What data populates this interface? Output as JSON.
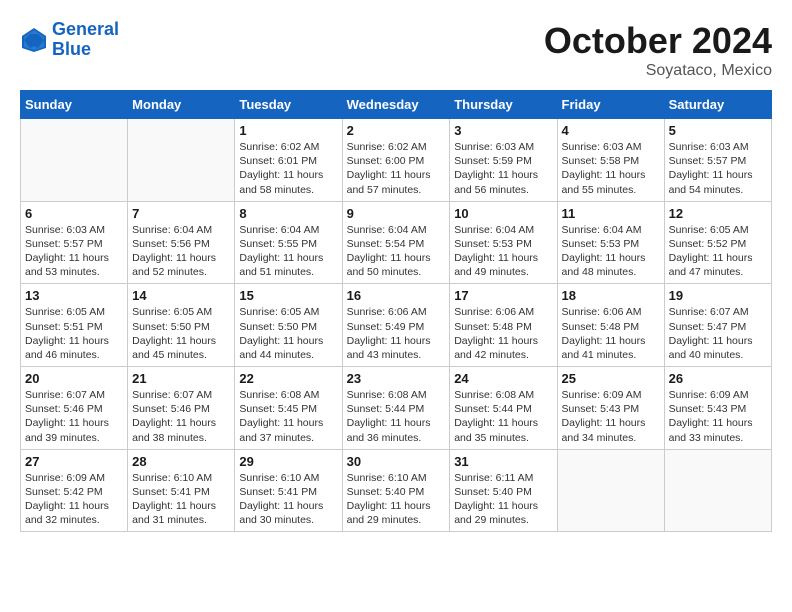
{
  "header": {
    "logo_line1": "General",
    "logo_line2": "Blue",
    "month": "October 2024",
    "location": "Soyataco, Mexico"
  },
  "weekdays": [
    "Sunday",
    "Monday",
    "Tuesday",
    "Wednesday",
    "Thursday",
    "Friday",
    "Saturday"
  ],
  "weeks": [
    [
      {
        "day": "",
        "info": ""
      },
      {
        "day": "",
        "info": ""
      },
      {
        "day": "1",
        "info": "Sunrise: 6:02 AM\nSunset: 6:01 PM\nDaylight: 11 hours and 58 minutes."
      },
      {
        "day": "2",
        "info": "Sunrise: 6:02 AM\nSunset: 6:00 PM\nDaylight: 11 hours and 57 minutes."
      },
      {
        "day": "3",
        "info": "Sunrise: 6:03 AM\nSunset: 5:59 PM\nDaylight: 11 hours and 56 minutes."
      },
      {
        "day": "4",
        "info": "Sunrise: 6:03 AM\nSunset: 5:58 PM\nDaylight: 11 hours and 55 minutes."
      },
      {
        "day": "5",
        "info": "Sunrise: 6:03 AM\nSunset: 5:57 PM\nDaylight: 11 hours and 54 minutes."
      }
    ],
    [
      {
        "day": "6",
        "info": "Sunrise: 6:03 AM\nSunset: 5:57 PM\nDaylight: 11 hours and 53 minutes."
      },
      {
        "day": "7",
        "info": "Sunrise: 6:04 AM\nSunset: 5:56 PM\nDaylight: 11 hours and 52 minutes."
      },
      {
        "day": "8",
        "info": "Sunrise: 6:04 AM\nSunset: 5:55 PM\nDaylight: 11 hours and 51 minutes."
      },
      {
        "day": "9",
        "info": "Sunrise: 6:04 AM\nSunset: 5:54 PM\nDaylight: 11 hours and 50 minutes."
      },
      {
        "day": "10",
        "info": "Sunrise: 6:04 AM\nSunset: 5:53 PM\nDaylight: 11 hours and 49 minutes."
      },
      {
        "day": "11",
        "info": "Sunrise: 6:04 AM\nSunset: 5:53 PM\nDaylight: 11 hours and 48 minutes."
      },
      {
        "day": "12",
        "info": "Sunrise: 6:05 AM\nSunset: 5:52 PM\nDaylight: 11 hours and 47 minutes."
      }
    ],
    [
      {
        "day": "13",
        "info": "Sunrise: 6:05 AM\nSunset: 5:51 PM\nDaylight: 11 hours and 46 minutes."
      },
      {
        "day": "14",
        "info": "Sunrise: 6:05 AM\nSunset: 5:50 PM\nDaylight: 11 hours and 45 minutes."
      },
      {
        "day": "15",
        "info": "Sunrise: 6:05 AM\nSunset: 5:50 PM\nDaylight: 11 hours and 44 minutes."
      },
      {
        "day": "16",
        "info": "Sunrise: 6:06 AM\nSunset: 5:49 PM\nDaylight: 11 hours and 43 minutes."
      },
      {
        "day": "17",
        "info": "Sunrise: 6:06 AM\nSunset: 5:48 PM\nDaylight: 11 hours and 42 minutes."
      },
      {
        "day": "18",
        "info": "Sunrise: 6:06 AM\nSunset: 5:48 PM\nDaylight: 11 hours and 41 minutes."
      },
      {
        "day": "19",
        "info": "Sunrise: 6:07 AM\nSunset: 5:47 PM\nDaylight: 11 hours and 40 minutes."
      }
    ],
    [
      {
        "day": "20",
        "info": "Sunrise: 6:07 AM\nSunset: 5:46 PM\nDaylight: 11 hours and 39 minutes."
      },
      {
        "day": "21",
        "info": "Sunrise: 6:07 AM\nSunset: 5:46 PM\nDaylight: 11 hours and 38 minutes."
      },
      {
        "day": "22",
        "info": "Sunrise: 6:08 AM\nSunset: 5:45 PM\nDaylight: 11 hours and 37 minutes."
      },
      {
        "day": "23",
        "info": "Sunrise: 6:08 AM\nSunset: 5:44 PM\nDaylight: 11 hours and 36 minutes."
      },
      {
        "day": "24",
        "info": "Sunrise: 6:08 AM\nSunset: 5:44 PM\nDaylight: 11 hours and 35 minutes."
      },
      {
        "day": "25",
        "info": "Sunrise: 6:09 AM\nSunset: 5:43 PM\nDaylight: 11 hours and 34 minutes."
      },
      {
        "day": "26",
        "info": "Sunrise: 6:09 AM\nSunset: 5:43 PM\nDaylight: 11 hours and 33 minutes."
      }
    ],
    [
      {
        "day": "27",
        "info": "Sunrise: 6:09 AM\nSunset: 5:42 PM\nDaylight: 11 hours and 32 minutes."
      },
      {
        "day": "28",
        "info": "Sunrise: 6:10 AM\nSunset: 5:41 PM\nDaylight: 11 hours and 31 minutes."
      },
      {
        "day": "29",
        "info": "Sunrise: 6:10 AM\nSunset: 5:41 PM\nDaylight: 11 hours and 30 minutes."
      },
      {
        "day": "30",
        "info": "Sunrise: 6:10 AM\nSunset: 5:40 PM\nDaylight: 11 hours and 29 minutes."
      },
      {
        "day": "31",
        "info": "Sunrise: 6:11 AM\nSunset: 5:40 PM\nDaylight: 11 hours and 29 minutes."
      },
      {
        "day": "",
        "info": ""
      },
      {
        "day": "",
        "info": ""
      }
    ]
  ]
}
